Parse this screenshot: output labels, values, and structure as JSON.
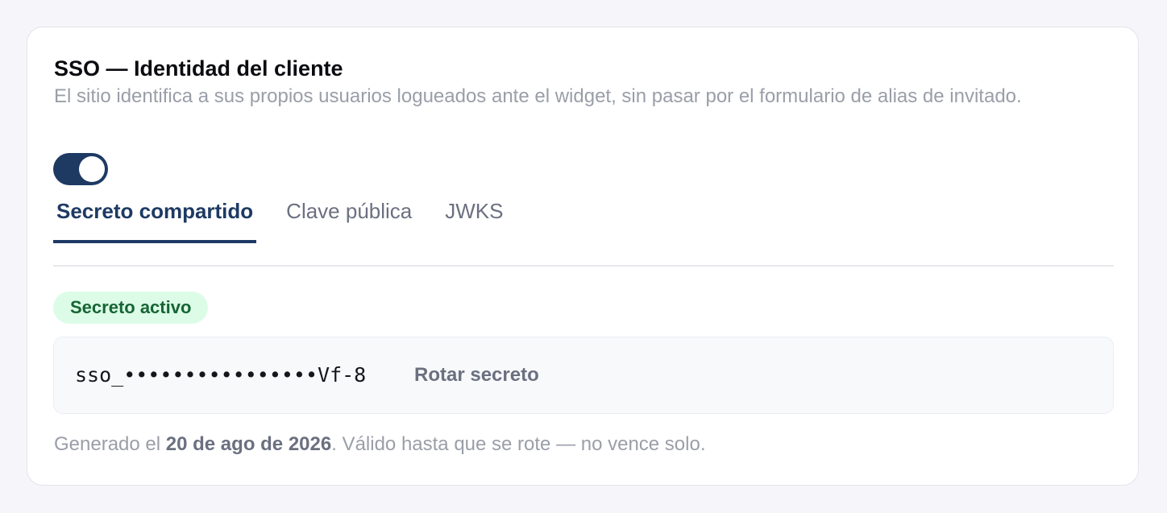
{
  "card": {
    "title": "SSO — Identidad del cliente",
    "description": "El sitio identifica a sus propios usuarios logueados ante el widget, sin pasar por el formulario de alias de invitado.",
    "toggle": {
      "state": "on",
      "color": "#1e3a63"
    }
  },
  "tabs": [
    {
      "label": "Secreto compartido",
      "active": true
    },
    {
      "label": "Clave pública",
      "active": false
    },
    {
      "label": "JWKS",
      "active": false
    }
  ],
  "secret": {
    "status_badge": "Secreto activo",
    "masked_value": "sso_••••••••••••••••Vf-8",
    "rotate_label": "Rotar secreto"
  },
  "footnote": {
    "prefix": "Generado el ",
    "date": "20 de ago de 2026",
    "suffix": ". Válido hasta que se rote — no vence solo."
  },
  "colors": {
    "accent": "#1e3a63",
    "badge_bg": "#dcfce7",
    "badge_text": "#166534",
    "muted_text": "#9a9ea8"
  }
}
